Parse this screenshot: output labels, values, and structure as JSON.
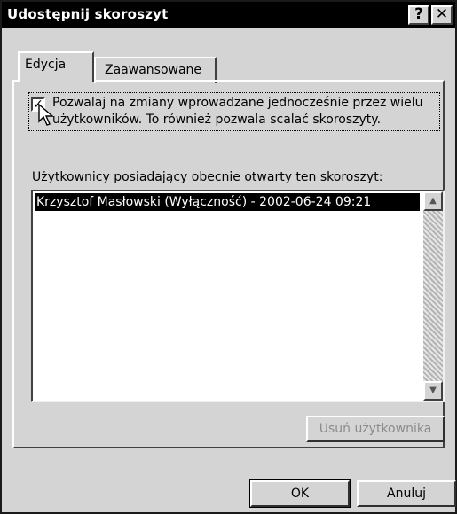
{
  "window": {
    "title": "Udostępnij skoroszyt",
    "help_glyph": "?",
    "close_glyph": "✕"
  },
  "tabs": [
    {
      "label": "Edycja",
      "selected": true
    },
    {
      "label": "Zaawansowane",
      "selected": false
    }
  ],
  "allow_changes": {
    "checked": true,
    "check_glyph": "✓",
    "label": "Pozwalaj na zmiany wprowadzane jednocześnie przez wielu użytkowników. To również pozwala scalać skoroszyty."
  },
  "users": {
    "label": "Użytkownicy posiadający obecnie otwarty ten skoroszyt:",
    "items": [
      "Krzysztof Masłowski (Wyłączność) - 2002-06-24 09:21"
    ]
  },
  "buttons": {
    "remove_user": "Usuń użytkownika",
    "ok": "OK",
    "cancel": "Anuluj"
  },
  "scroll": {
    "up_glyph": "▲",
    "down_glyph": "▼"
  },
  "colors": {
    "titlebar": "#000000",
    "dialog_face": "#d4d4d4",
    "selection": "#000000"
  }
}
